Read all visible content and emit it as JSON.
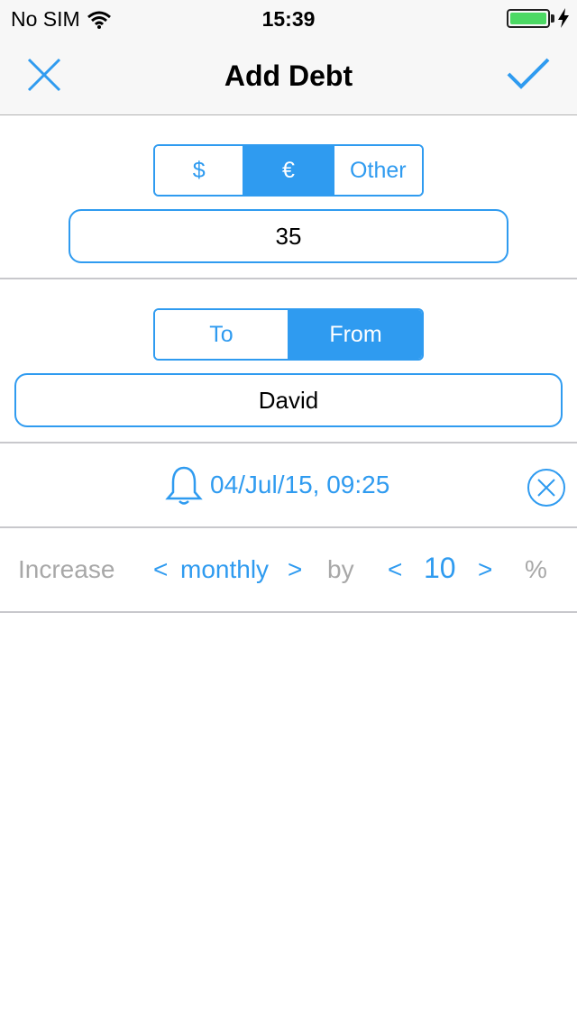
{
  "status_bar": {
    "carrier": "No SIM",
    "time": "15:39",
    "wifi_icon": "wifi-icon",
    "battery_icon": "battery-icon",
    "charging_icon": "charging-bolt-icon"
  },
  "nav": {
    "title": "Add Debt",
    "close_icon": "close-icon",
    "done_icon": "checkmark-icon"
  },
  "currency": {
    "options": [
      "$",
      "€",
      "Other"
    ],
    "selected": "€"
  },
  "amount": {
    "value": "35"
  },
  "direction": {
    "options": [
      "To",
      "From"
    ],
    "selected": "From"
  },
  "person": {
    "value": "David"
  },
  "reminder": {
    "icon": "bell-icon",
    "date": "04/Jul/15, 09:25",
    "clear_icon": "clear-circle-icon"
  },
  "increase": {
    "label": "Increase",
    "prev": "<",
    "period": "monthly",
    "next": ">",
    "by": "by",
    "decrement": "<",
    "value": "10",
    "increment": ">",
    "unit": "%"
  },
  "colors": {
    "accent": "#2f9bf0",
    "muted_text": "#a8a8a8",
    "bar_bg": "#f7f7f7",
    "battery": "#4cd964"
  }
}
